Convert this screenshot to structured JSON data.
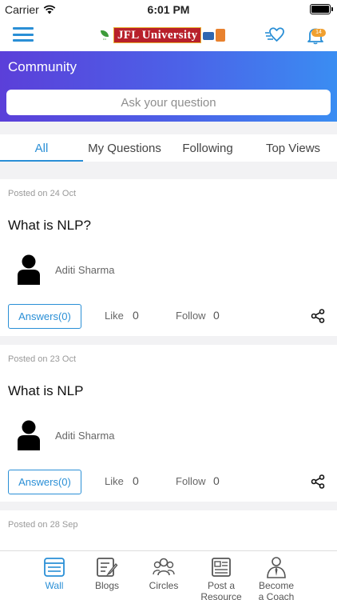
{
  "status": {
    "carrier": "Carrier",
    "time": "6:01 PM"
  },
  "header": {
    "logo": {
      "brand_text": "JFL University"
    },
    "notification_count": "14"
  },
  "community": {
    "title": "Community",
    "ask_placeholder": "Ask your question"
  },
  "tabs": [
    {
      "label": "All",
      "active": true
    },
    {
      "label": "My Questions",
      "active": false
    },
    {
      "label": "Following",
      "active": false
    },
    {
      "label": "Top Views",
      "active": false
    }
  ],
  "posts": [
    {
      "posted": "Posted on 24 Oct",
      "question": "What is NLP?",
      "author": "Aditi Sharma",
      "answers_label": "Answers(0)",
      "like_label": "Like",
      "like_count": "0",
      "follow_label": "Follow",
      "follow_count": "0"
    },
    {
      "posted": "Posted on 23 Oct",
      "question": "What is NLP",
      "author": "Aditi Sharma",
      "answers_label": "Answers(0)",
      "like_label": "Like",
      "like_count": "0",
      "follow_label": "Follow",
      "follow_count": "0"
    },
    {
      "posted": "Posted on 28 Sep"
    }
  ],
  "bottom_nav": [
    {
      "label": "Wall",
      "icon": "wall-icon",
      "active": true
    },
    {
      "label": "Blogs",
      "icon": "blog-icon",
      "active": false
    },
    {
      "label": "Circles",
      "icon": "circles-icon",
      "active": false
    },
    {
      "label_line1": "Post a",
      "label_line2": "Resource",
      "icon": "post-resource-icon",
      "active": false
    },
    {
      "label_line1": "Become",
      "label_line2": "a Coach",
      "icon": "coach-icon",
      "active": false
    }
  ],
  "colors": {
    "accent": "#2a8fd6",
    "gradient_start": "#5b3fd9",
    "gradient_end": "#3a8df2",
    "badge": "#f0a030"
  }
}
